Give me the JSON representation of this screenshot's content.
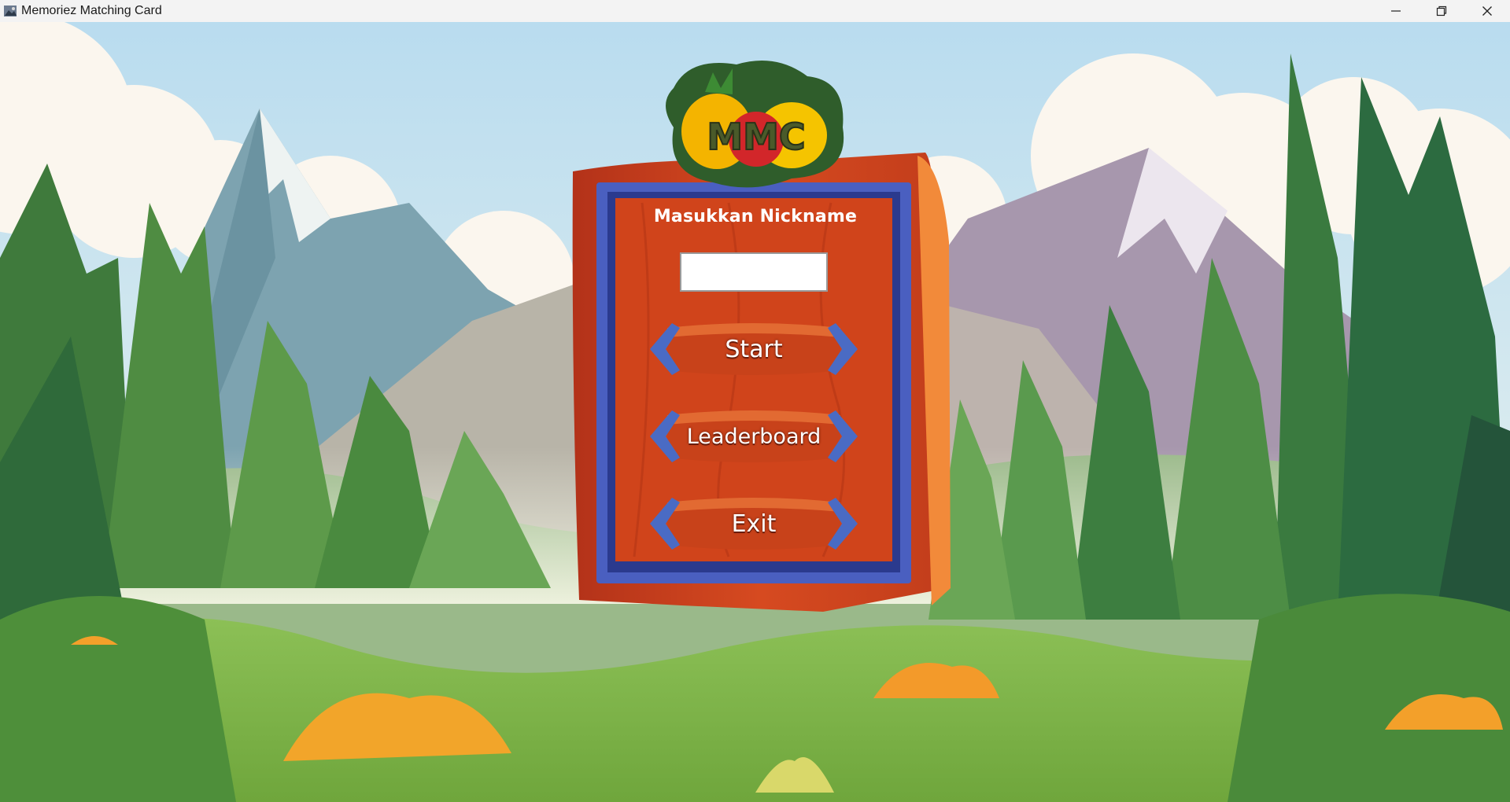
{
  "window": {
    "title": "Memoriez Matching Card",
    "controls": [
      "minimize-icon",
      "restore-icon",
      "close-icon"
    ]
  },
  "logo": {
    "text": "MMC"
  },
  "panel": {
    "title": "Masukkan Nickname",
    "nickname_value": "",
    "nickname_placeholder": ""
  },
  "menu": {
    "start_label": "Start",
    "leaderboard_label": "Leaderboard",
    "exit_label": "Exit"
  },
  "colors": {
    "board": "#d2451c",
    "board_frame": "#3f52b8",
    "button_wood": "#c8421a",
    "button_cap": "#4a6bc4",
    "sky": "#bfe0f0"
  }
}
